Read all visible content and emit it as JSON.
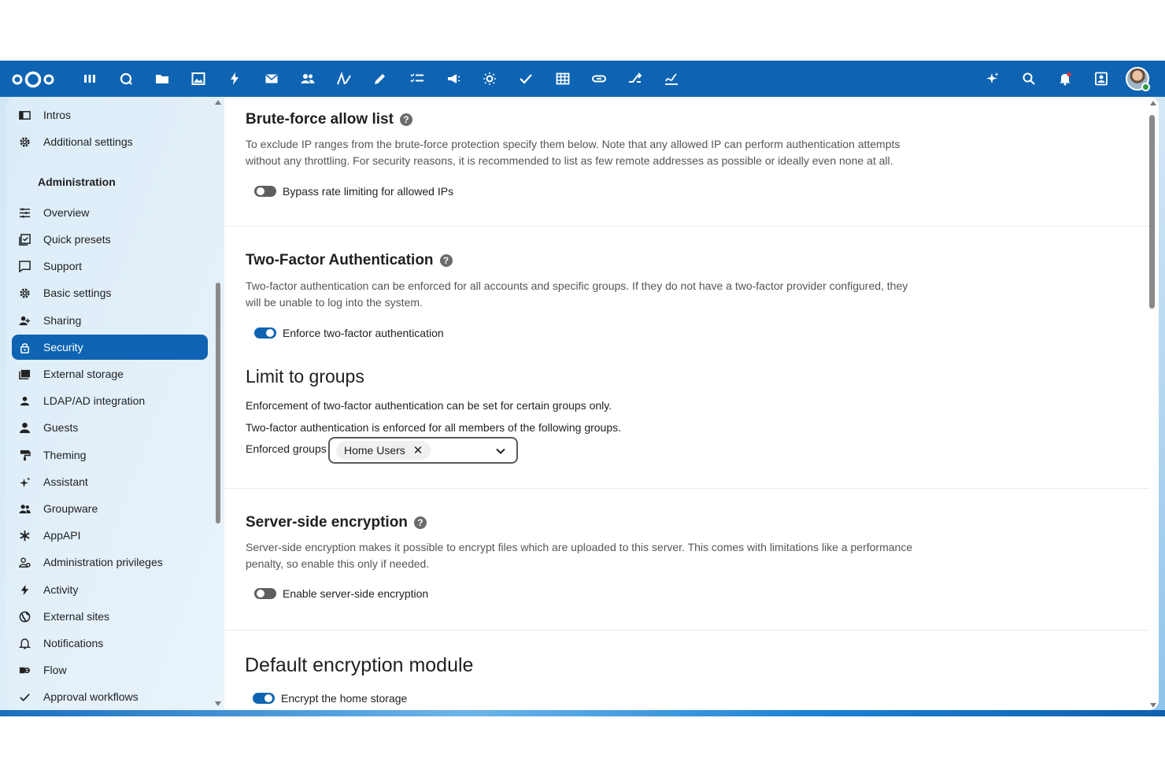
{
  "header": {
    "icons": [
      "dashboard-icon",
      "talk-icon",
      "files-icon",
      "photos-icon",
      "activity-icon",
      "mail-icon",
      "contacts-icon",
      "text-icon",
      "notes-icon",
      "tasks-icon",
      "announcements-icon",
      "weather-icon",
      "deck-icon",
      "tables-icon",
      "links-icon",
      "flow-icon",
      "sign-icon"
    ],
    "right_icons": [
      "assistant-icon",
      "search-icon",
      "notifications-icon",
      "contacts-menu-icon"
    ]
  },
  "sidebar": {
    "top_items": [
      {
        "label": "Intros",
        "icon": "intros-icon"
      },
      {
        "label": "Additional settings",
        "icon": "gear-icon"
      }
    ],
    "heading": "Administration",
    "items": [
      {
        "label": "Overview",
        "icon": "overview-icon"
      },
      {
        "label": "Quick presets",
        "icon": "presets-icon"
      },
      {
        "label": "Support",
        "icon": "support-icon"
      },
      {
        "label": "Basic settings",
        "icon": "gear-icon"
      },
      {
        "label": "Sharing",
        "icon": "sharing-icon"
      },
      {
        "label": "Security",
        "icon": "lock-icon",
        "active": true
      },
      {
        "label": "External storage",
        "icon": "storage-icon"
      },
      {
        "label": "LDAP/AD integration",
        "icon": "user-icon"
      },
      {
        "label": "Guests",
        "icon": "guest-icon"
      },
      {
        "label": "Theming",
        "icon": "theming-icon"
      },
      {
        "label": "Assistant",
        "icon": "sparkle-icon"
      },
      {
        "label": "Groupware",
        "icon": "group-icon"
      },
      {
        "label": "AppAPI",
        "icon": "appapi-icon"
      },
      {
        "label": "Administration privileges",
        "icon": "admin-privileges-icon"
      },
      {
        "label": "Activity",
        "icon": "activity-icon"
      },
      {
        "label": "External sites",
        "icon": "globe-icon"
      },
      {
        "label": "Notifications",
        "icon": "bell-icon"
      },
      {
        "label": "Flow",
        "icon": "flow-icon"
      },
      {
        "label": "Approval workflows",
        "icon": "check-icon"
      }
    ]
  },
  "content": {
    "bruteforce": {
      "title": "Brute-force allow list",
      "desc": "To exclude IP ranges from the brute-force protection specify them below. Note that any allowed IP can perform authentication attempts without any throttling. For security reasons, it is recommended to list as few remote addresses as possible or ideally even none at all.",
      "toggle_label": "Bypass rate limiting for allowed IPs",
      "toggle_on": false
    },
    "twofactor": {
      "title": "Two-Factor Authentication",
      "desc": "Two-factor authentication can be enforced for all accounts and specific groups. If they do not have a two-factor provider configured, they will be unable to log into the system.",
      "toggle_label": "Enforce two-factor authentication",
      "toggle_on": true
    },
    "limit_groups": {
      "title": "Limit to groups",
      "line1": "Enforcement of two-factor authentication can be set for certain groups only.",
      "line2": "Two-factor authentication is enforced for all members of the following groups.",
      "field_label": "Enforced groups",
      "selected_group": "Home Users",
      "remove_glyph": "✕"
    },
    "encryption": {
      "title": "Server-side encryption",
      "desc": "Server-side encryption makes it possible to encrypt files which are uploaded to this server. This comes with limitations like a performance penalty, so enable this only if needed.",
      "toggle_label": "Enable server-side encryption",
      "toggle_on": false
    },
    "default_module": {
      "title": "Default encryption module",
      "toggle_label": "Encrypt the home storage",
      "toggle_on": true
    },
    "help_glyph": "?"
  },
  "colors": {
    "accent": "#0e64b2",
    "toggle_off": "#5e5e5e"
  }
}
